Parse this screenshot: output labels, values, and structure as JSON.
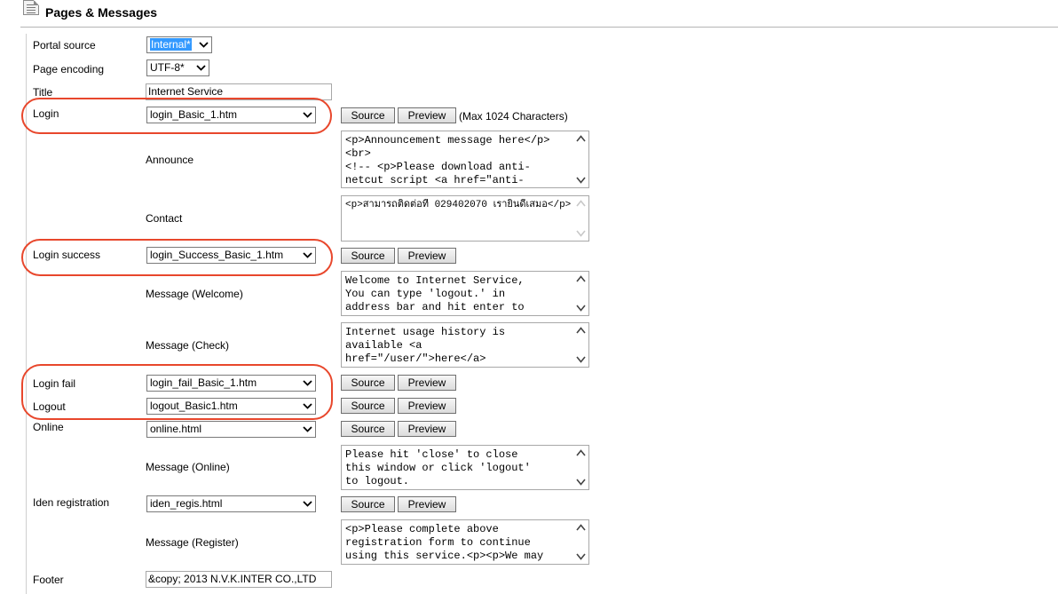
{
  "header": {
    "title": "Pages & Messages",
    "icon": "document-icon"
  },
  "portal_source": {
    "label": "Portal source",
    "value": "Internal*"
  },
  "page_encoding": {
    "label": "Page encoding",
    "value": "UTF-8*"
  },
  "title_field": {
    "label": "Title",
    "value": "Internet Service"
  },
  "login": {
    "label": "Login",
    "value": "login_Basic_1.htm",
    "source_label": "Source",
    "preview_label": "Preview",
    "max_note": "(Max 1024 Characters)"
  },
  "announce": {
    "label": "Announce",
    "text": "<p>Announcement message here</p>\n<br>\n<!-- <p>Please download anti-\nnetcut script <a href=\"anti-"
  },
  "contact": {
    "label": "Contact",
    "text": "<p>สามารถติดต่อที่ 029402070 เรายินดีเสมอ</p>"
  },
  "login_success": {
    "label": "Login success",
    "value": "login_Success_Basic_1.htm",
    "source_label": "Source",
    "preview_label": "Preview"
  },
  "message_welcome": {
    "label": "Message (Welcome)",
    "text": "Welcome to Internet Service,\nYou can type 'logout.' in\naddress bar and hit enter to"
  },
  "message_check": {
    "label": "Message (Check)",
    "text": "Internet usage history is\navailable <a\nhref=\"/user/\">here</a>"
  },
  "login_fail": {
    "label": "Login fail",
    "value": "login_fail_Basic_1.htm",
    "source_label": "Source",
    "preview_label": "Preview"
  },
  "logout": {
    "label": "Logout",
    "value": "logout_Basic1.htm",
    "source_label": "Source",
    "preview_label": "Preview"
  },
  "online": {
    "label": "Online",
    "value": "online.html",
    "source_label": "Source",
    "preview_label": "Preview"
  },
  "message_online": {
    "label": "Message (Online)",
    "text": "Please hit 'close' to close\nthis window or click 'logout'\nto logout."
  },
  "iden_registration": {
    "label": "Iden registration",
    "value": "iden_regis.html",
    "source_label": "Source",
    "preview_label": "Preview"
  },
  "message_register": {
    "label": "Message (Register)",
    "text": "<p>Please complete above\nregistration form to continue\nusing this service.<p><p>We may"
  },
  "footer": {
    "label": "Footer",
    "value": "&copy; 2013  N.V.K.INTER CO.,LTD"
  },
  "colors": {
    "highlight": "#3399ff",
    "callout": "#e8472c"
  }
}
